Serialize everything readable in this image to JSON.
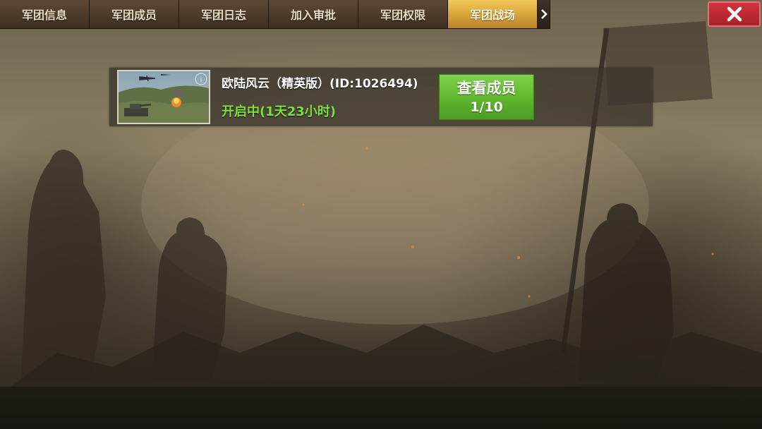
{
  "tabs": [
    {
      "label": "军团信息",
      "active": false
    },
    {
      "label": "军团成员",
      "active": false
    },
    {
      "label": "军团日志",
      "active": false
    },
    {
      "label": "加入审批",
      "active": false
    },
    {
      "label": "军团权限",
      "active": false
    },
    {
      "label": "军团战场",
      "active": true
    }
  ],
  "tab_more_icon": "chevron-right-icon",
  "close_icon": "close-icon",
  "battlefield": {
    "title": "欧陆风云（精英版）(ID:1026494)",
    "status": "开启中(1天23小时)",
    "status_color": "#7ee03a",
    "view_button_label": "查看成员",
    "member_count": "1/10"
  },
  "colors": {
    "active_tab": "#e0ac42",
    "close_button": "#c02a33",
    "view_button": "#62b730"
  }
}
